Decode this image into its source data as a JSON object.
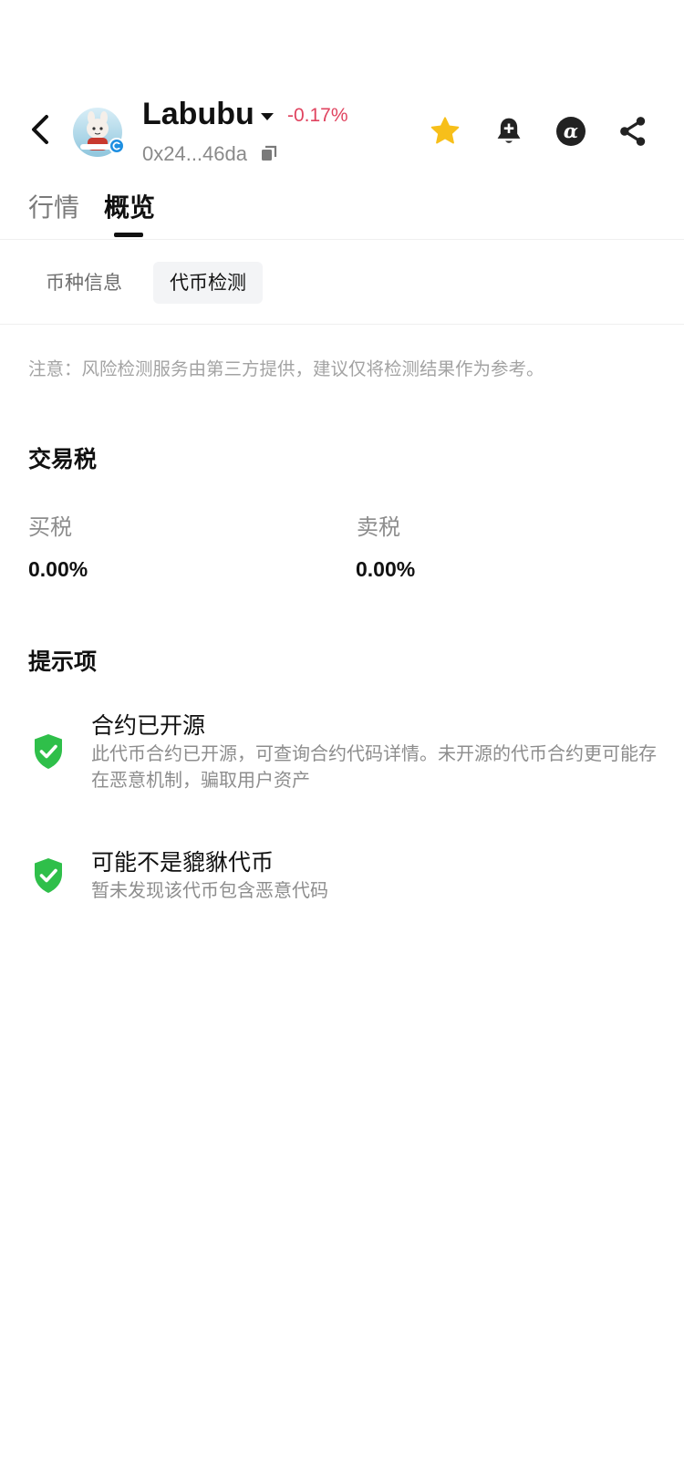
{
  "header": {
    "token_name": "Labubu",
    "change_pct": "-0.17%",
    "address": "0x24...46da",
    "icons": {
      "back": "chevron-left-icon",
      "caret": "caret-down-icon",
      "copy": "copy-icon",
      "favorite": "star-icon",
      "alert": "bell-plus-icon",
      "alpha": "alpha-icon",
      "share": "share-icon"
    },
    "colors": {
      "change_negative": "#e0435f",
      "favorite_star": "#f7bf1a"
    }
  },
  "tabs": [
    {
      "label": "行情",
      "active": false
    },
    {
      "label": "概览",
      "active": true
    }
  ],
  "subtabs": [
    {
      "label": "币种信息",
      "active": false
    },
    {
      "label": "代币检测",
      "active": true
    }
  ],
  "notice": "注意：风险检测服务由第三方提供，建议仅将检测结果作为参考。",
  "tax": {
    "title": "交易税",
    "buy_label": "买税",
    "buy_value": "0.00%",
    "sell_label": "卖税",
    "sell_value": "0.00%"
  },
  "tips": {
    "title": "提示项",
    "items": [
      {
        "icon": "shield-check-icon",
        "title": "合约已开源",
        "desc": "此代币合约已开源，可查询合约代码详情。未开源的代币合约更可能存在恶意机制，骗取用户资产"
      },
      {
        "icon": "shield-check-icon",
        "title": "可能不是貔貅代币",
        "desc": "暂未发现该代币包含恶意代码"
      }
    ],
    "check_color": "#2fbf4a"
  }
}
